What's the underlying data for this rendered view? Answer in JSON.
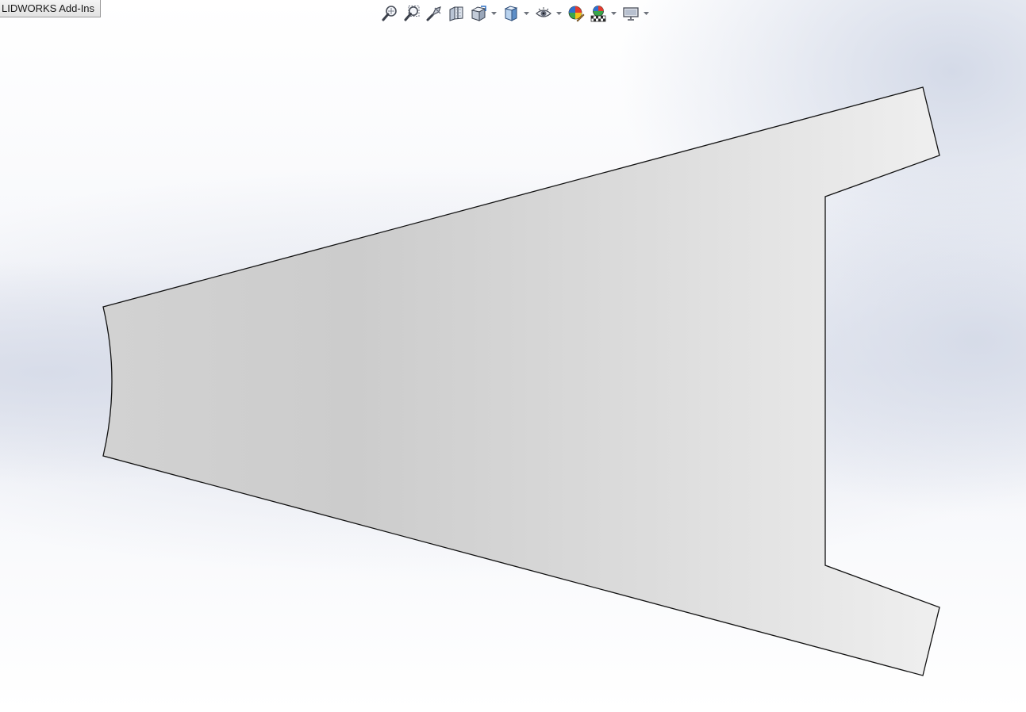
{
  "window": {
    "addins_tab_label": "LIDWORKS Add-Ins"
  },
  "toolbar": {
    "items": [
      {
        "icon": "zoom-to-fit-icon"
      },
      {
        "icon": "zoom-to-area-icon"
      },
      {
        "icon": "previous-view-icon"
      },
      {
        "icon": "section-view-icon"
      },
      {
        "icon": "view-orientation-icon",
        "has_dropdown": true
      },
      {
        "icon": "display-style-icon",
        "has_dropdown": true
      },
      {
        "icon": "hide-show-items-icon",
        "has_dropdown": true
      },
      {
        "icon": "edit-appearance-icon"
      },
      {
        "icon": "apply-scene-icon",
        "has_dropdown": true
      },
      {
        "icon": "view-settings-icon",
        "has_dropdown": true
      }
    ]
  },
  "colors": {
    "part_face_light": "#ececec",
    "part_face_dark": "#c9c9c9",
    "part_edge": "#111111",
    "background_tint": "#dfe3ee"
  },
  "model": {
    "shape": "tapered plate with concave arc end and rectangular slot"
  }
}
